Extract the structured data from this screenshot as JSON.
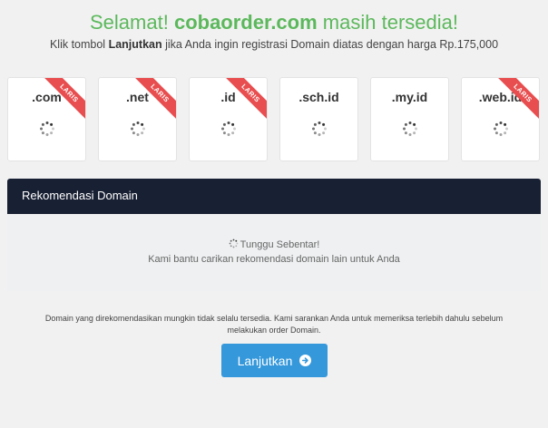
{
  "header": {
    "prefix": "Selamat!",
    "domain": "cobaorder.com",
    "suffix": "masih tersedia!",
    "sub_before": "Klik tombol",
    "sub_button_ref": "Lanjutkan",
    "sub_after": "jika Anda ingin registrasi Domain diatas dengan harga Rp.175,000"
  },
  "tlds": [
    {
      "name": ".com",
      "badge": "LARIS"
    },
    {
      "name": ".net",
      "badge": "LARIS"
    },
    {
      "name": ".id",
      "badge": "LARIS"
    },
    {
      "name": ".sch.id",
      "badge": ""
    },
    {
      "name": ".my.id",
      "badge": ""
    },
    {
      "name": ".web.id",
      "badge": "LARIS"
    }
  ],
  "recommendation": {
    "title": "Rekomendasi Domain",
    "wait_text": "Tunggu Sebentar!",
    "help_text": "Kami bantu carikan rekomendasi domain lain untuk Anda"
  },
  "note": "Domain yang direkomendasikan mungkin tidak selalu tersedia. Kami sarankan Anda untuk memeriksa terlebih dahulu sebelum melakukan order Domain.",
  "continue_button": {
    "label": "Lanjutkan",
    "icon": "arrow-circle-right-icon"
  },
  "colors": {
    "success": "#5cb85c",
    "ribbon": "#e84e4f",
    "header_bg": "#182033",
    "button": "#3498db"
  }
}
